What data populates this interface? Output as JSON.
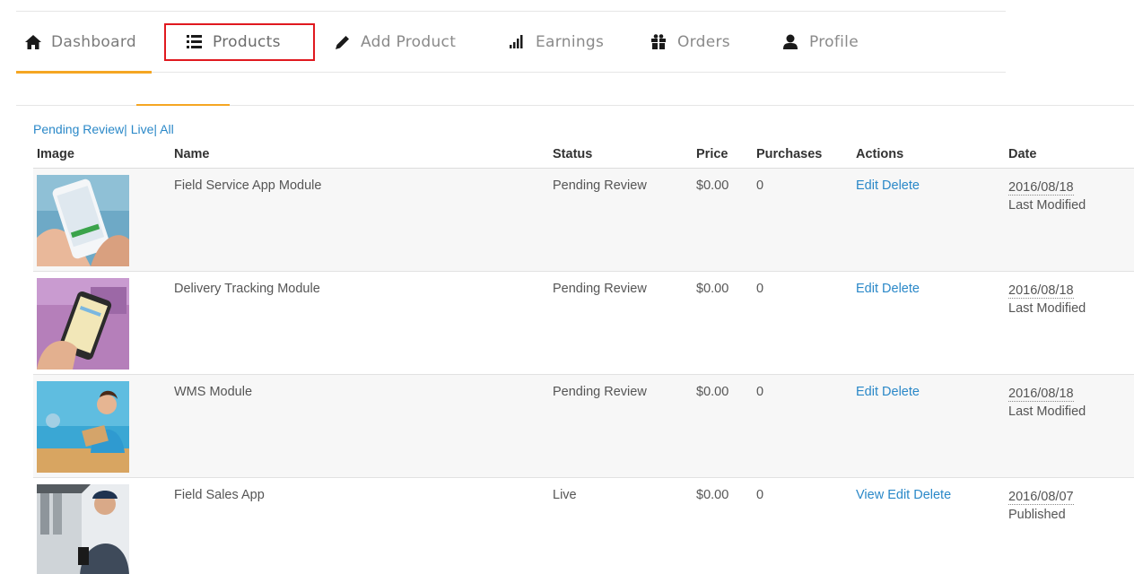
{
  "nav": {
    "tabs": [
      {
        "label": "Dashboard",
        "icon": "home-icon"
      },
      {
        "label": "Products",
        "icon": "list-icon"
      },
      {
        "label": "Add Product",
        "icon": "pencil-icon"
      },
      {
        "label": "Earnings",
        "icon": "bar-chart-icon"
      },
      {
        "label": "Orders",
        "icon": "gift-icon"
      },
      {
        "label": "Profile",
        "icon": "user-icon"
      }
    ],
    "active_color": "#f5a623",
    "highlight_color": "#e0191f"
  },
  "filters": {
    "pending": "Pending Review",
    "live": "Live",
    "all": "All",
    "separator": "|"
  },
  "table": {
    "headers": {
      "image": "Image",
      "name": "Name",
      "status": "Status",
      "price": "Price",
      "purchases": "Purchases",
      "actions": "Actions",
      "date": "Date"
    },
    "rows": [
      {
        "name": "Field Service App Module",
        "status": "Pending Review",
        "price": "$0.00",
        "purchases": "0",
        "view": "",
        "edit": "Edit",
        "delete": "Delete",
        "date": "2016/08/18",
        "date_note": "Last Modified"
      },
      {
        "name": "Delivery Tracking Module",
        "status": "Pending Review",
        "price": "$0.00",
        "purchases": "0",
        "view": "",
        "edit": "Edit",
        "delete": "Delete",
        "date": "2016/08/18",
        "date_note": "Last Modified"
      },
      {
        "name": "WMS Module",
        "status": "Pending Review",
        "price": "$0.00",
        "purchases": "0",
        "view": "",
        "edit": "Edit",
        "delete": "Delete",
        "date": "2016/08/18",
        "date_note": "Last Modified"
      },
      {
        "name": "Field Sales App",
        "status": "Live",
        "price": "$0.00",
        "purchases": "0",
        "view": "View",
        "edit": "Edit",
        "delete": "Delete",
        "date": "2016/08/07",
        "date_note": "Published"
      }
    ]
  },
  "colors": {
    "link": "#2a88c8",
    "accent": "#f5a623"
  }
}
